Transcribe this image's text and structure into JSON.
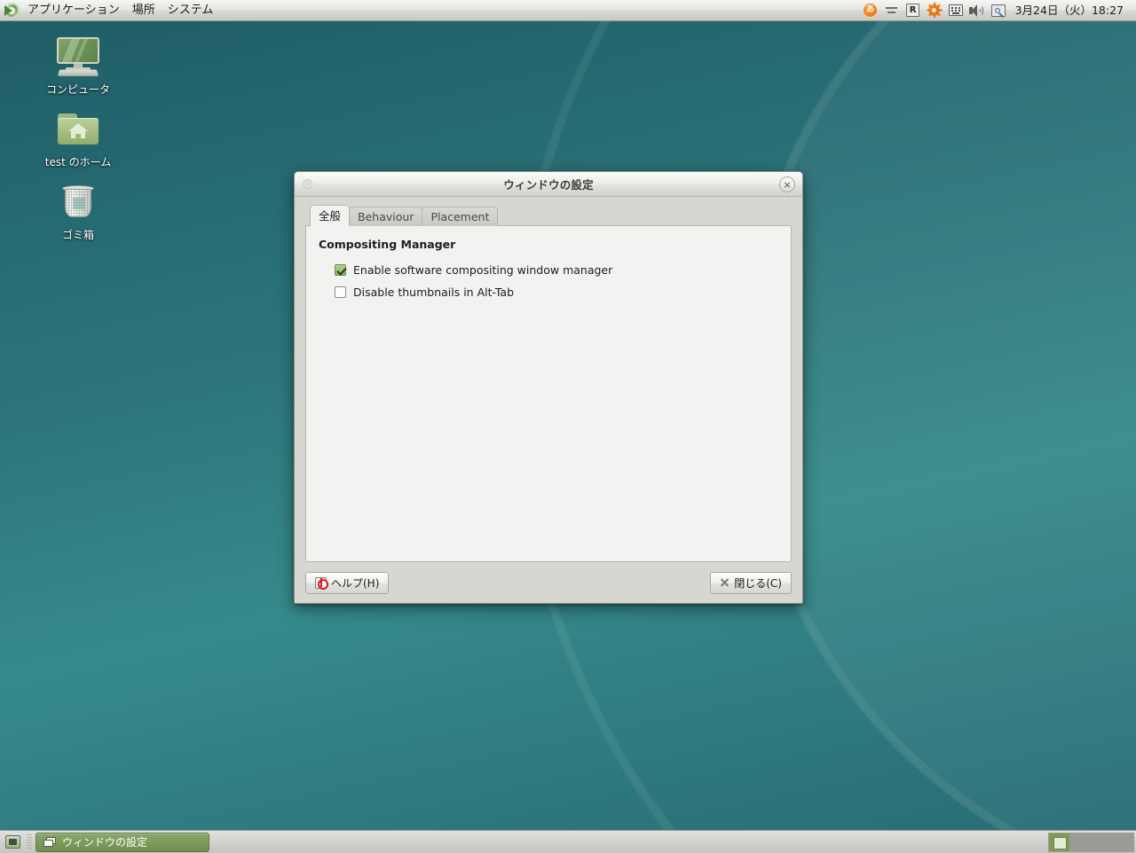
{
  "top_panel": {
    "logo_icon": "mate-swirl-logo-icon",
    "menus": [
      {
        "label": "アプリケーション",
        "name": "menu-applications"
      },
      {
        "label": "場所",
        "name": "menu-places"
      },
      {
        "label": "システム",
        "name": "menu-system"
      }
    ],
    "tray": [
      {
        "name": "ime-indicator-icon",
        "glyph": "あ"
      },
      {
        "name": "keyboard-dash-indicator-icon"
      },
      {
        "name": "recorder-r-indicator-icon",
        "glyph": "R"
      },
      {
        "name": "settings-gear-icon"
      },
      {
        "name": "keyboard-layout-icon"
      },
      {
        "name": "volume-speaker-icon"
      },
      {
        "name": "magnifier-key-icon"
      }
    ],
    "clock": "3月24日（火）18:27"
  },
  "desktop": {
    "icons": [
      {
        "name": "desktop-icon-computer",
        "label": "コンピュータ",
        "art": "computer-monitor-icon"
      },
      {
        "name": "desktop-icon-home",
        "label": "test のホーム",
        "art": "home-folder-icon"
      },
      {
        "name": "desktop-icon-trash",
        "label": "ゴミ箱",
        "art": "trash-bin-icon"
      }
    ]
  },
  "window": {
    "title": "ウィンドウの設定",
    "menu_button_icon": "window-menu-icon",
    "close_button_icon": "window-close-icon",
    "close_button_glyph": "×",
    "tabs": [
      {
        "label": "全般",
        "name": "tab-general",
        "active": true
      },
      {
        "label": "Behaviour",
        "name": "tab-behaviour",
        "active": false
      },
      {
        "label": "Placement",
        "name": "tab-placement",
        "active": false
      }
    ],
    "section_title": "Compositing Manager",
    "checkboxes": [
      {
        "name": "checkbox-enable-software-compositing",
        "label": "Enable software compositing window manager",
        "checked": true
      },
      {
        "name": "checkbox-disable-thumbnails-alt-tab",
        "label": "Disable thumbnails in Alt-Tab",
        "checked": false
      }
    ],
    "help_button": {
      "label": "ヘルプ(H)",
      "icon": "help-lifebuoy-icon"
    },
    "close_button": {
      "label": "閉じる(C)",
      "icon": "close-x-icon"
    }
  },
  "bottom_panel": {
    "show_desktop_icon": "show-desktop-icon",
    "tasks": [
      {
        "name": "taskbar-item-window-settings",
        "label": "ウィンドウの設定",
        "icon": "window-stack-icon",
        "active": true
      }
    ],
    "workspaces": [
      {
        "name": "workspace-1",
        "active": true
      },
      {
        "name": "workspace-2",
        "active": false
      },
      {
        "name": "workspace-3",
        "active": false
      },
      {
        "name": "workspace-4",
        "active": false
      }
    ]
  },
  "colors": {
    "desktop_teal": "#2e7b80",
    "accent_green": "#7d9b57",
    "panel_gray": "#d2d2ce",
    "checkbox_green": "#8fae62"
  }
}
